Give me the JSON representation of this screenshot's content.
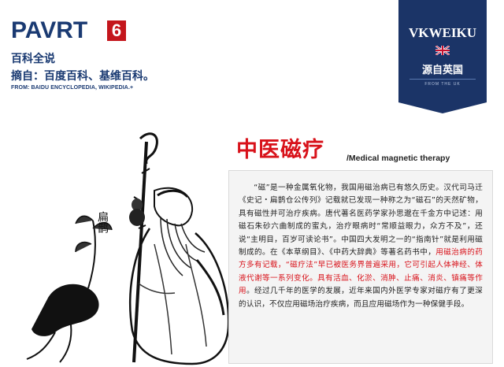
{
  "header": {
    "brand_word": "PAVRT",
    "part_number": "6",
    "section": "百科全说",
    "source": "摘自：百度百科、基维百科。",
    "source_en": "FROM: BAIDU ENCYCLOPEDIA, WIKIPEDIA.+"
  },
  "badge": {
    "name": "VKWEIKU",
    "origin": "源自英国",
    "small": "FROM THE UK",
    "flag_icon": "uk-flag-icon",
    "background": "#1b3467"
  },
  "illustration": {
    "caption": "扁鹊"
  },
  "article": {
    "title": "中医磁疗",
    "subtitle": "/Medical magnetic therapy",
    "accent_color": "#d8121a",
    "p1": "“磁”是一种金属氧化物，我国用磁治病已有悠久历史。汉代司马迁《史记・扁鹊仓公传列》记载就已发现一种称之为“磁石”的天然矿物，具有磁性并可治疗疾病。唐代著名医药学家孙思邈在千金方中记述：用磁石朱砂六曲制成的蜜丸，治疗眼病时“常顺益眼力，众方不及”，还说“主明目，百岁可读论书”。中国四大发明之一的“指南针”就是利用磁制成的。在《本草纲目》、《中药大辞典》等著名药书中，",
    "p1_red": "用磁治病的药方多有记载，“磁疗法”早已被医务界普遍采用，它可引起人体神经、体液代谢等一系列变化。具有活血、化淤、消肿、止痛、消炎、镇痛等作用",
    "p1_end": "。经过几千年的医学的发展，近年来国内外医学专家对磁疗有了更深的认识，不仅应用磁场治疗疾病，而且应用磁场作为一种保健手段。"
  }
}
